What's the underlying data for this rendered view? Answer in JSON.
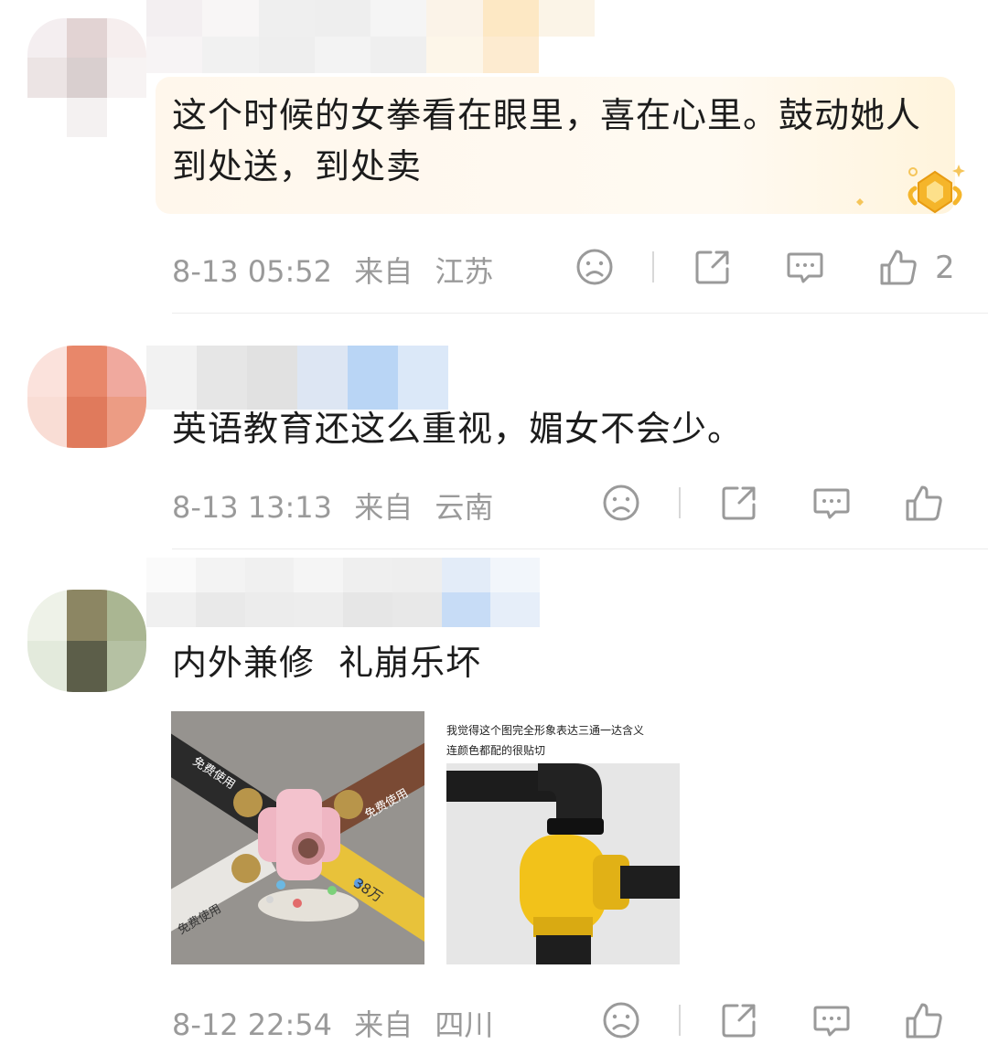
{
  "comments": [
    {
      "text": "这个时候的女拳看在眼里，喜在心里。鼓动她人到处送，到处卖",
      "date": "8-13 05:52",
      "from_label": "来自",
      "location": "江苏",
      "like_count": "2"
    },
    {
      "text": "英语教育还这么重视，媚女不会少。",
      "date": "8-13 13:13",
      "from_label": "来自",
      "location": "云南"
    },
    {
      "text": "内外兼修  礼崩乐坏",
      "date": "8-12 22:54",
      "from_label": "来自",
      "location": "四川",
      "images": [
        {
          "labels": [
            "免费使用",
            "免费使用",
            "免费使用",
            "38万"
          ]
        },
        {
          "caption_line1": "我觉得这个图完全形象表达三通一达含义",
          "caption_line2": "连颜色都配的很贴切"
        }
      ]
    }
  ],
  "icons": {
    "dislike": "sad-face-icon",
    "share": "share-icon",
    "reply": "comment-icon",
    "like": "thumbs-up-icon",
    "badge": "gold-badge-icon"
  },
  "colors": {
    "meta_text": "#9a9a9a",
    "icon_stroke": "#9a9a9a",
    "highlight_bg": "#fff7ec",
    "badge_gold": "#f5b52a"
  }
}
